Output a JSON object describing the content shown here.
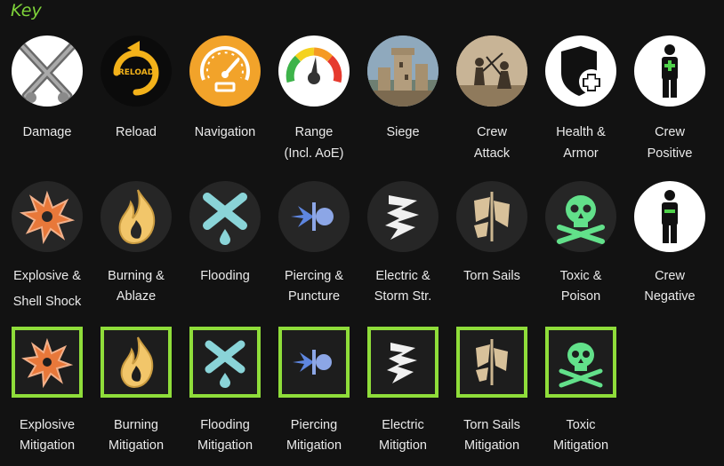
{
  "title": "Key",
  "colors": {
    "accent": "#7fd43a",
    "mitigation_border": "#8fdd3a"
  },
  "row1": [
    {
      "icon": "crossed-cannons-icon",
      "line1": "Damage"
    },
    {
      "icon": "reload-icon",
      "line1": "Reload",
      "icon_text": "RELOAD"
    },
    {
      "icon": "speedometer-icon",
      "line1": "Navigation"
    },
    {
      "icon": "range-gauge-icon",
      "line1": "Range",
      "line2": "(Incl. AoE)"
    },
    {
      "icon": "castle-icon",
      "line1": "Siege"
    },
    {
      "icon": "swordfight-icon",
      "line1": "Crew",
      "line2": "Attack"
    },
    {
      "icon": "shield-plus-icon",
      "line1": "Health &",
      "line2": "Armor"
    },
    {
      "icon": "person-plus-icon",
      "line1": "Crew",
      "line2": "Positive"
    }
  ],
  "row2": [
    {
      "icon": "explosion-icon",
      "line1": "Explosive &",
      "line2": "Shell Shock"
    },
    {
      "icon": "flame-icon",
      "line1": "Burning &",
      "line2": "Ablaze"
    },
    {
      "icon": "water-drop-cross-icon",
      "line1": "Flooding"
    },
    {
      "icon": "piercing-shot-icon",
      "line1": "Piercing &",
      "line2": "Puncture"
    },
    {
      "icon": "lightning-icon",
      "line1": "Electric &",
      "line2": "Storm Str."
    },
    {
      "icon": "torn-sail-icon",
      "line1": "Torn Sails"
    },
    {
      "icon": "skull-crossbones-icon",
      "line1": "Toxic &",
      "line2": "Poison"
    },
    {
      "icon": "person-minus-icon",
      "line1": "Crew",
      "line2": "Negative"
    }
  ],
  "row3": [
    {
      "icon": "explosion-icon",
      "line1": "Explosive",
      "line2": "Mitigation"
    },
    {
      "icon": "flame-icon",
      "line1": "Burning",
      "line2": "Mitigation"
    },
    {
      "icon": "water-drop-cross-icon",
      "line1": "Flooding",
      "line2": "Mitigation"
    },
    {
      "icon": "piercing-shot-icon",
      "line1": "Piercing",
      "line2": "Mitigation"
    },
    {
      "icon": "lightning-icon",
      "line1": "Electric",
      "line2": "Mitigtion"
    },
    {
      "icon": "torn-sail-icon",
      "line1": "Torn Sails",
      "line2": "Mitigation"
    },
    {
      "icon": "skull-crossbones-icon",
      "line1": "Toxic",
      "line2": "Mitigation"
    }
  ]
}
